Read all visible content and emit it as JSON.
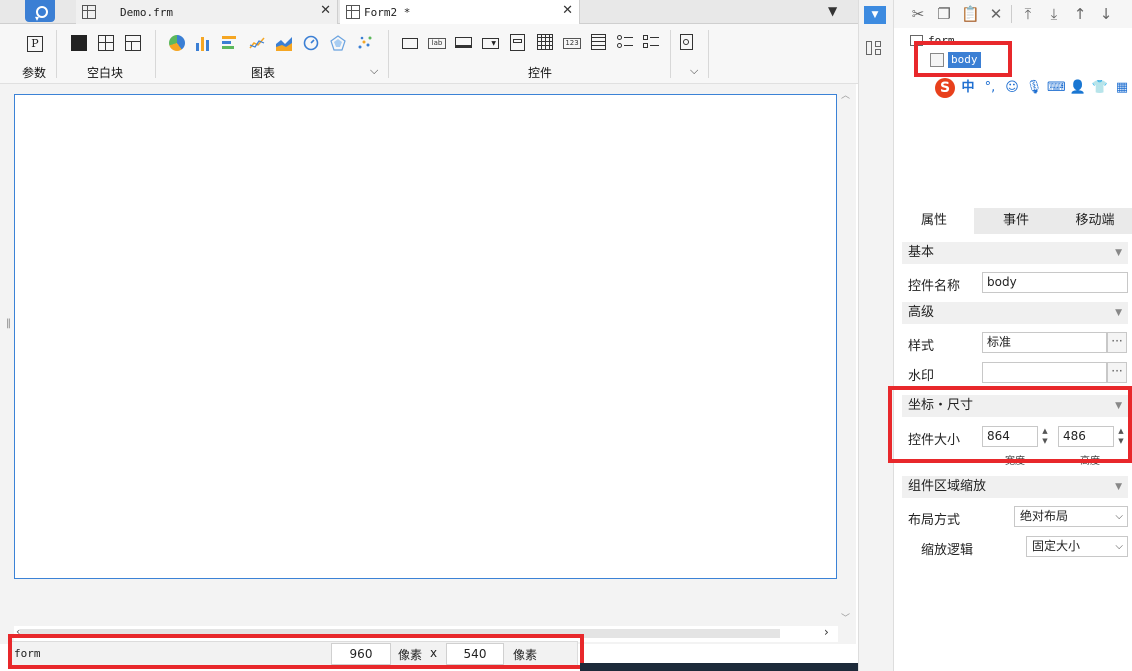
{
  "tabs": [
    {
      "label": "Demo.frm",
      "active": false
    },
    {
      "label": "Form2 *",
      "active": true
    }
  ],
  "ribbon": {
    "groups": {
      "param": "参数",
      "blank": "空白块",
      "chart": "图表",
      "widget": "控件"
    },
    "param_icon_letter": "P",
    "lab_icon_text": "lab",
    "num_icon_text": "123"
  },
  "status": {
    "name": "form",
    "width": "960",
    "unit1": "像素",
    "x": "x",
    "height": "540",
    "unit2": "像素"
  },
  "tree": {
    "root": "form",
    "selected": "body"
  },
  "ime": {
    "logo": "S",
    "mode": "中",
    "punct": "°,"
  },
  "panel": {
    "tabs": [
      "属性",
      "事件",
      "移动端"
    ],
    "sections": {
      "basic": "基本",
      "advanced": "高级",
      "position": "坐标・尺寸",
      "scale": "组件区域缩放"
    },
    "fields": {
      "name_label": "控件名称",
      "name_value": "body",
      "style_label": "样式",
      "style_value": "标准",
      "watermark_label": "水印",
      "watermark_value": "",
      "size_label": "控件大小",
      "size_width": "864",
      "size_height": "486",
      "width_caption": "宽度",
      "height_caption": "高度",
      "layout_label": "布局方式",
      "layout_value": "绝对布局",
      "scale_logic_label": "缩放逻辑",
      "scale_logic_value": "固定大小"
    },
    "dots": "···"
  },
  "colors": {
    "accent": "#3b7fd4",
    "highlight": "#e8282b"
  }
}
